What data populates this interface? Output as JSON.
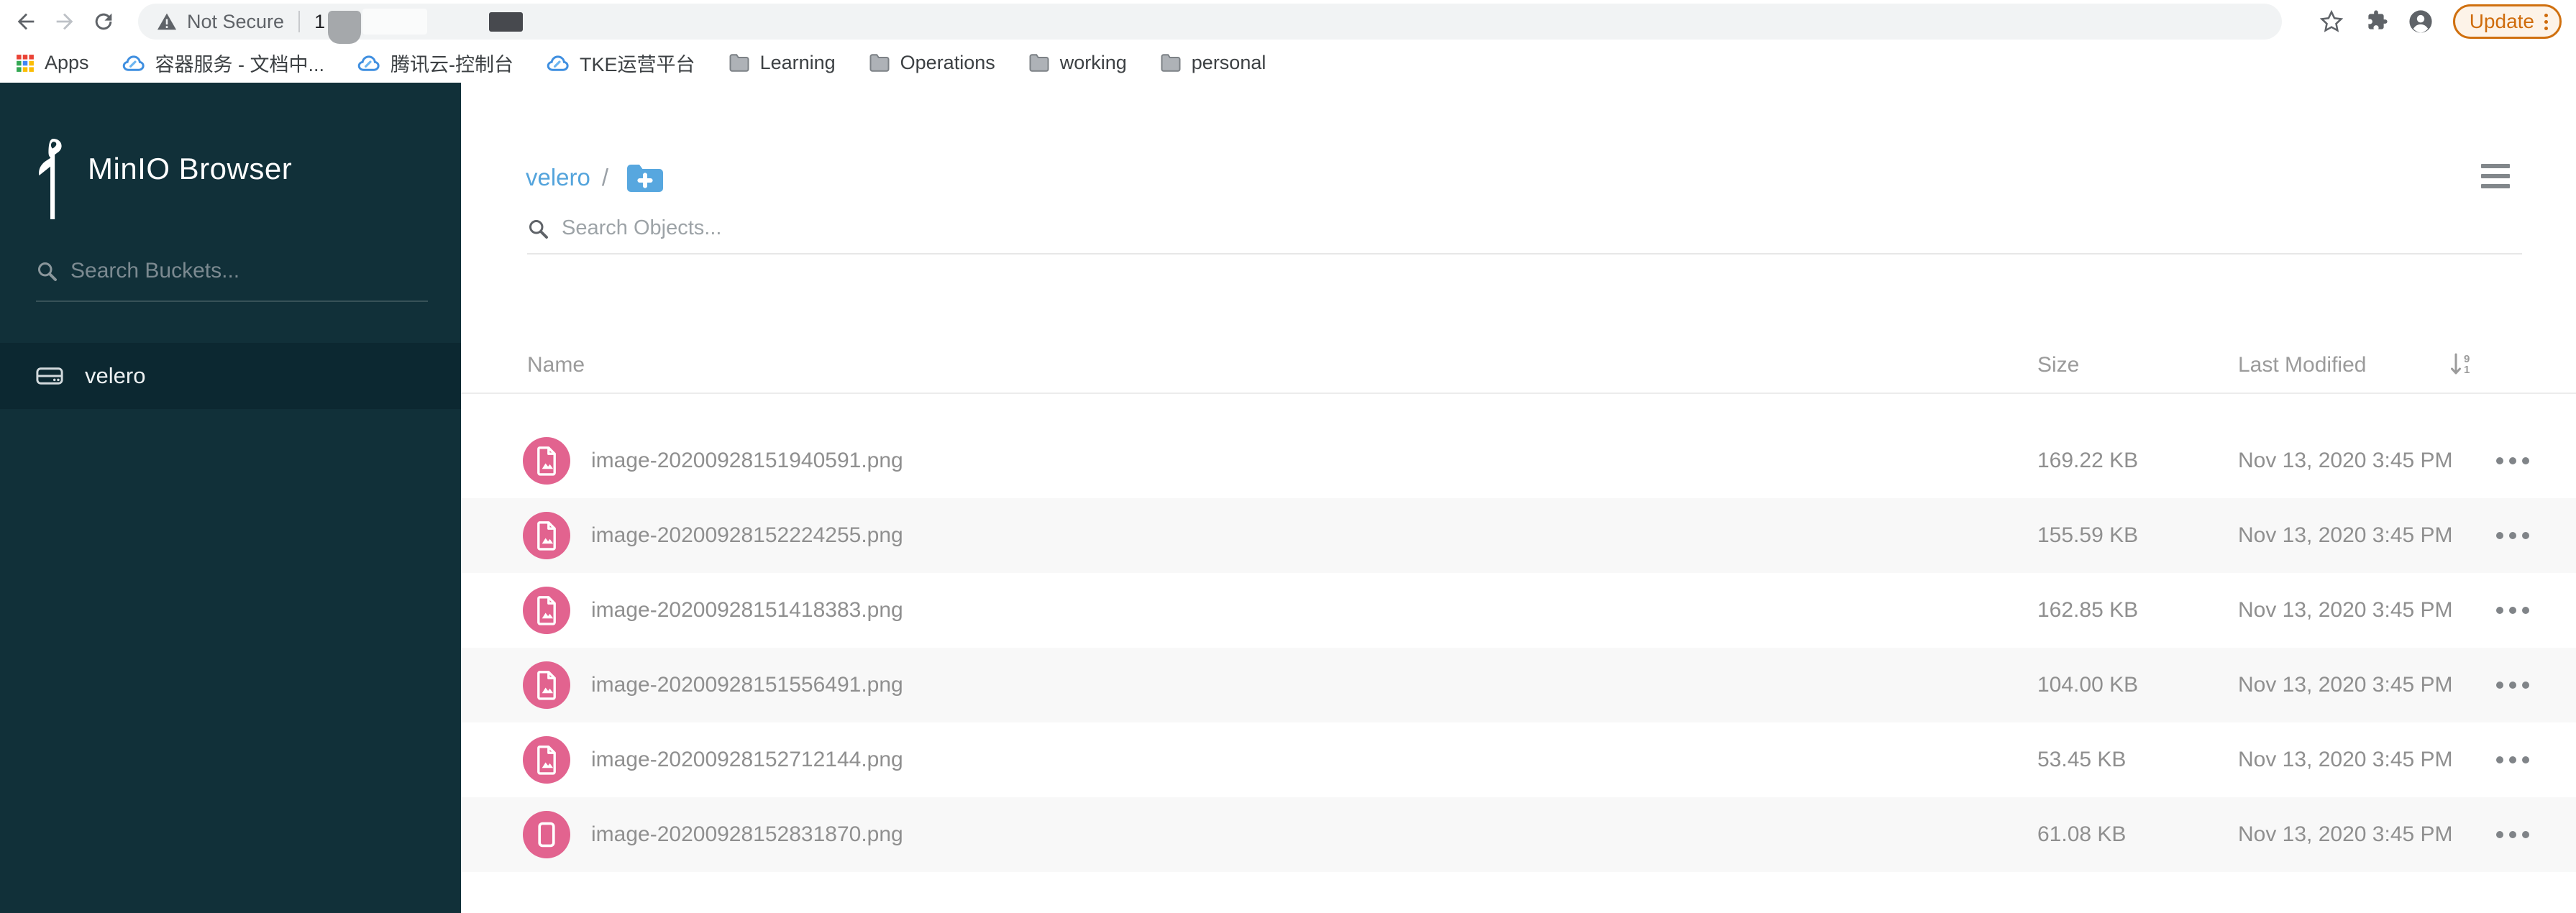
{
  "browser": {
    "security_label": "Not Secure",
    "url_visible_prefix": "1",
    "update_button": "Update",
    "bookmarks": [
      {
        "label": "Apps",
        "icon": "apps-grid"
      },
      {
        "label": "容器服务 - 文档中...",
        "icon": "tencent-cloud"
      },
      {
        "label": "腾讯云-控制台",
        "icon": "tencent-cloud"
      },
      {
        "label": "TKE运营平台",
        "icon": "tencent-cloud"
      },
      {
        "label": "Learning",
        "icon": "folder"
      },
      {
        "label": "Operations",
        "icon": "folder"
      },
      {
        "label": "working",
        "icon": "folder"
      },
      {
        "label": "personal",
        "icon": "folder"
      }
    ]
  },
  "sidebar": {
    "app_title": "MinIO Browser",
    "search_placeholder": "Search Buckets...",
    "buckets": [
      {
        "name": "velero",
        "selected": true
      }
    ]
  },
  "main": {
    "breadcrumb": {
      "bucket": "velero",
      "separator": "/"
    },
    "search_placeholder": "Search Objects...",
    "table": {
      "columns": {
        "name": "Name",
        "size": "Size",
        "modified": "Last Modified"
      },
      "rows": [
        {
          "name": "image-20200928151940591.png",
          "size": "169.22 KB",
          "modified": "Nov 13, 2020 3:45 PM",
          "icon": "file-image"
        },
        {
          "name": "image-20200928152224255.png",
          "size": "155.59 KB",
          "modified": "Nov 13, 2020 3:45 PM",
          "icon": "file-image"
        },
        {
          "name": "image-20200928151418383.png",
          "size": "162.85 KB",
          "modified": "Nov 13, 2020 3:45 PM",
          "icon": "file-image"
        },
        {
          "name": "image-20200928151556491.png",
          "size": "104.00 KB",
          "modified": "Nov 13, 2020 3:45 PM",
          "icon": "file-image"
        },
        {
          "name": "image-20200928152712144.png",
          "size": "53.45 KB",
          "modified": "Nov 13, 2020 3:45 PM",
          "icon": "file-image"
        },
        {
          "name": "image-20200928152831870.png",
          "size": "61.08 KB",
          "modified": "Nov 13, 2020 3:45 PM",
          "icon": "file-generic"
        }
      ]
    }
  },
  "colors": {
    "sidebar_bg": "#113039",
    "sidebar_selected_bg": "#0c2831",
    "accent_blue": "#54a4dc",
    "file_icon_pink": "#e2638f",
    "update_orange": "#cf6c0c"
  }
}
